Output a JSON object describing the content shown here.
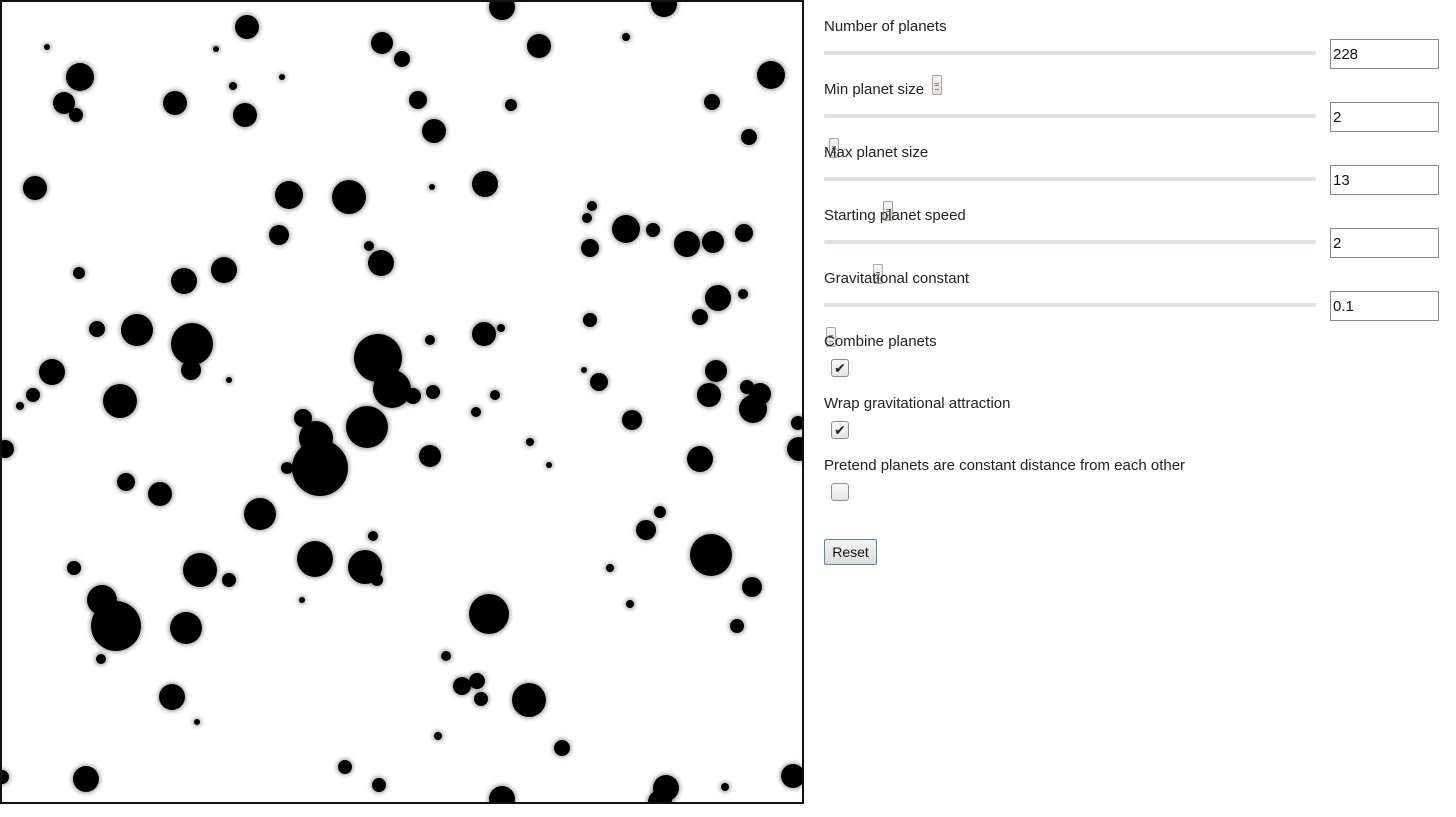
{
  "controls": {
    "sliders": [
      {
        "label": "Number of planets",
        "value": "228",
        "position": 0.23
      },
      {
        "label": "Min planet size",
        "value": "2",
        "position": 0.02
      },
      {
        "label": "Max planet size",
        "value": "13",
        "position": 0.13
      },
      {
        "label": "Starting planet speed",
        "value": "2",
        "position": 0.11
      },
      {
        "label": "Gravitational constant",
        "value": "0.1",
        "position": 0.015
      }
    ],
    "checkboxes": [
      {
        "label": "Combine planets",
        "checked": true
      },
      {
        "label": "Wrap gravitational attraction",
        "checked": true
      },
      {
        "label": "Pretend planets are constant distance from each other",
        "checked": false
      }
    ],
    "reset_label": "Reset"
  },
  "planets": [
    [
      245,
      25,
      12
    ],
    [
      500,
      5,
      13
    ],
    [
      662,
      2,
      13
    ],
    [
      45,
      45,
      3
    ],
    [
      214,
      47,
      3
    ],
    [
      380,
      41,
      11
    ],
    [
      400,
      57,
      8
    ],
    [
      537,
      44,
      12
    ],
    [
      624,
      35,
      4
    ],
    [
      78,
      75,
      14
    ],
    [
      280,
      75,
      3
    ],
    [
      231,
      84,
      4
    ],
    [
      769,
      73,
      14
    ],
    [
      62,
      101,
      11
    ],
    [
      74,
      113,
      7
    ],
    [
      173,
      101,
      12
    ],
    [
      243,
      113,
      12
    ],
    [
      416,
      98,
      9
    ],
    [
      509,
      103,
      6
    ],
    [
      710,
      100,
      8
    ],
    [
      432,
      129,
      12
    ],
    [
      747,
      135,
      8
    ],
    [
      33,
      186,
      12
    ],
    [
      287,
      193,
      14
    ],
    [
      347,
      195,
      17
    ],
    [
      430,
      185,
      3
    ],
    [
      483,
      182,
      13
    ],
    [
      590,
      204,
      5
    ],
    [
      585,
      216,
      5
    ],
    [
      624,
      227,
      14
    ],
    [
      651,
      228,
      7
    ],
    [
      277,
      233,
      10
    ],
    [
      367,
      244,
      5
    ],
    [
      379,
      261,
      13
    ],
    [
      588,
      246,
      9
    ],
    [
      685,
      242,
      13
    ],
    [
      711,
      240,
      11
    ],
    [
      742,
      231,
      9
    ],
    [
      77,
      271,
      6
    ],
    [
      182,
      279,
      13
    ],
    [
      222,
      268,
      13
    ],
    [
      716,
      296,
      13
    ],
    [
      741,
      292,
      5
    ],
    [
      698,
      315,
      8
    ],
    [
      95,
      327,
      8
    ],
    [
      135,
      328,
      16
    ],
    [
      190,
      342,
      21
    ],
    [
      189,
      368,
      10
    ],
    [
      482,
      332,
      12
    ],
    [
      499,
      326,
      4
    ],
    [
      428,
      338,
      5
    ],
    [
      588,
      318,
      7
    ],
    [
      376,
      356,
      24
    ],
    [
      390,
      387,
      19
    ],
    [
      50,
      370,
      13
    ],
    [
      31,
      393,
      7
    ],
    [
      18,
      404,
      4
    ],
    [
      227,
      378,
      3
    ],
    [
      411,
      394,
      8
    ],
    [
      431,
      390,
      7
    ],
    [
      493,
      393,
      5
    ],
    [
      582,
      368,
      3
    ],
    [
      597,
      380,
      9
    ],
    [
      714,
      369,
      11
    ],
    [
      745,
      385,
      7
    ],
    [
      758,
      392,
      11
    ],
    [
      707,
      393,
      12
    ],
    [
      751,
      407,
      14
    ],
    [
      118,
      399,
      17
    ],
    [
      301,
      416,
      9
    ],
    [
      314,
      436,
      17
    ],
    [
      365,
      425,
      21
    ],
    [
      318,
      466,
      28
    ],
    [
      285,
      466,
      6
    ],
    [
      474,
      410,
      5
    ],
    [
      528,
      440,
      4
    ],
    [
      547,
      463,
      3
    ],
    [
      630,
      418,
      10
    ],
    [
      428,
      454,
      11
    ],
    [
      698,
      457,
      13
    ],
    [
      796,
      421,
      7
    ],
    [
      797,
      447,
      12
    ],
    [
      3,
      447,
      9
    ],
    [
      124,
      480,
      9
    ],
    [
      158,
      492,
      12
    ],
    [
      258,
      512,
      16
    ],
    [
      371,
      534,
      5
    ],
    [
      644,
      528,
      10
    ],
    [
      658,
      510,
      6
    ],
    [
      709,
      553,
      21
    ],
    [
      313,
      557,
      18
    ],
    [
      363,
      565,
      17
    ],
    [
      375,
      578,
      6
    ],
    [
      198,
      568,
      17
    ],
    [
      227,
      578,
      7
    ],
    [
      608,
      566,
      4
    ],
    [
      750,
      585,
      10
    ],
    [
      72,
      566,
      7
    ],
    [
      100,
      598,
      15
    ],
    [
      114,
      624,
      25
    ],
    [
      184,
      626,
      16
    ],
    [
      300,
      598,
      3
    ],
    [
      487,
      612,
      20
    ],
    [
      628,
      602,
      4
    ],
    [
      735,
      624,
      7
    ],
    [
      99,
      657,
      5
    ],
    [
      444,
      654,
      5
    ],
    [
      475,
      679,
      8
    ],
    [
      460,
      684,
      9
    ],
    [
      479,
      697,
      7
    ],
    [
      527,
      698,
      17
    ],
    [
      170,
      695,
      13
    ],
    [
      195,
      720,
      3
    ],
    [
      436,
      734,
      4
    ],
    [
      560,
      746,
      8
    ],
    [
      343,
      765,
      7
    ],
    [
      377,
      783,
      7
    ],
    [
      84,
      777,
      13
    ],
    [
      0,
      775,
      7
    ],
    [
      500,
      797,
      13
    ],
    [
      664,
      786,
      13
    ],
    [
      723,
      785,
      4
    ],
    [
      791,
      774,
      12
    ],
    [
      658,
      800,
      12
    ]
  ]
}
